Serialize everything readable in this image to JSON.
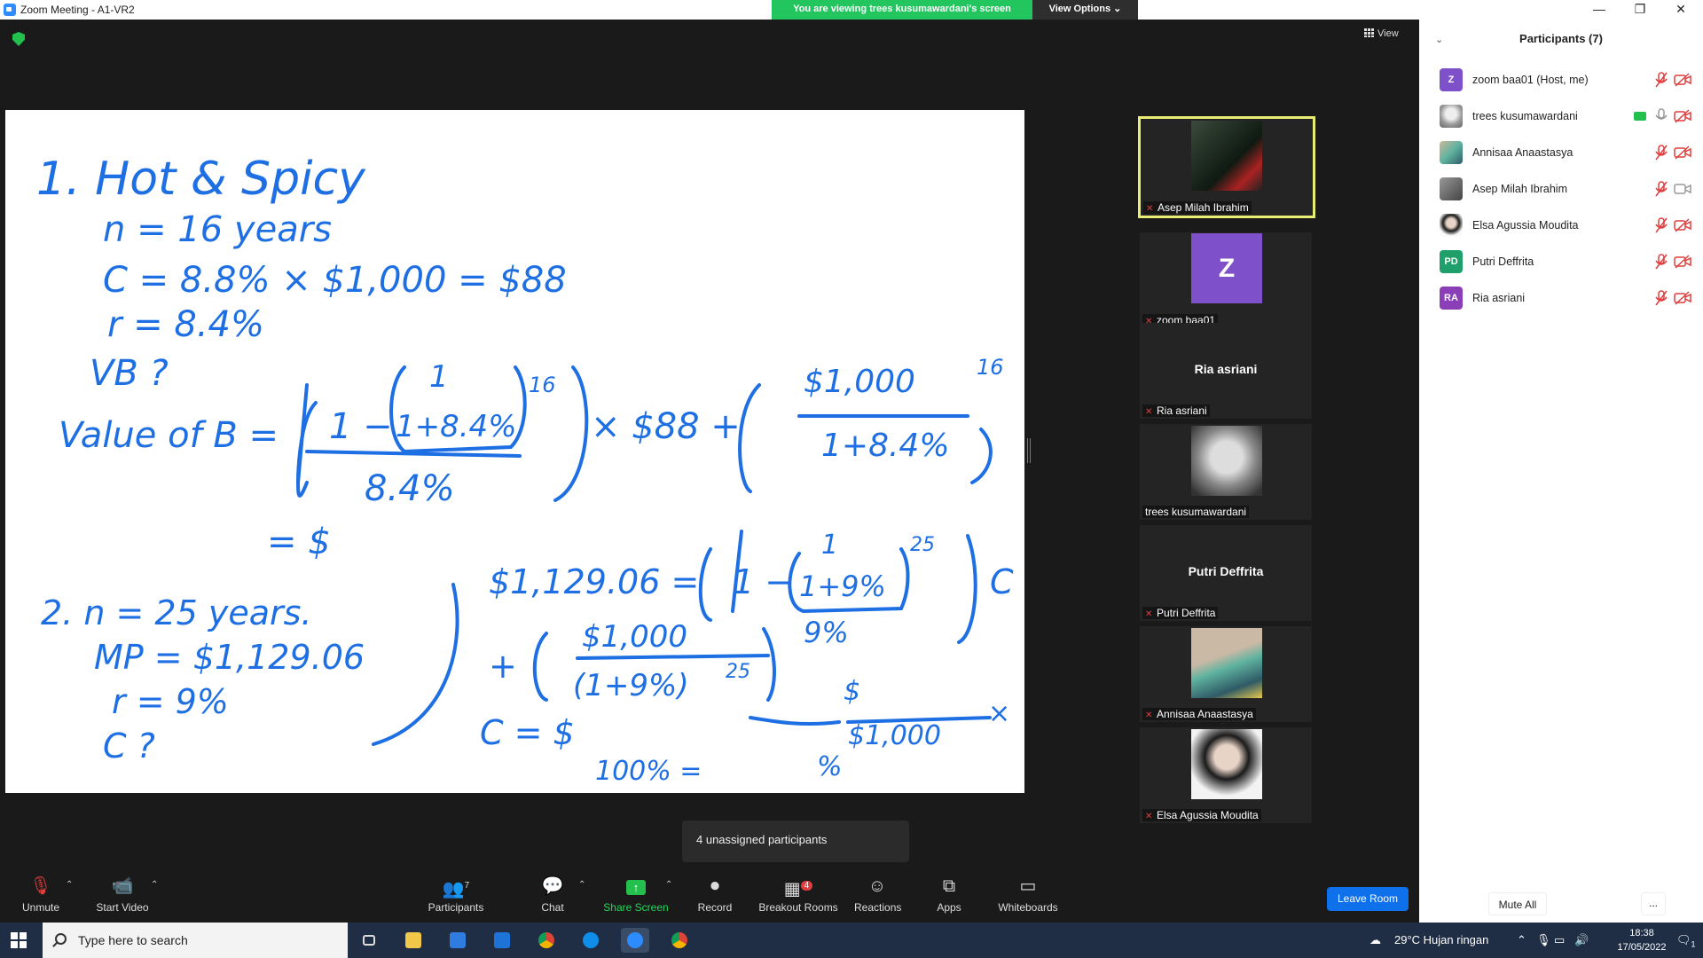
{
  "window": {
    "title": "Zoom Meeting - A1-VR2"
  },
  "banner": {
    "viewing_text": "You are viewing trees kusumawardani's screen",
    "view_options": "View Options"
  },
  "meeting": {
    "view_label": "View"
  },
  "whiteboard": {
    "line1": "1. Hot & Spicy",
    "line2": "n = 16 years",
    "line3": "C = 8.8% × $1,000 = $88",
    "line4": "r = 8.4%",
    "line5": "VB ?",
    "line6a": "Value of B =",
    "line6b": "1 −",
    "line6c": "1",
    "line6d": "1+8.4%",
    "line6e": "16",
    "line6f": "× $88 +",
    "line6g": "$1,000",
    "line6h": "1+8.4%",
    "line6i": "16",
    "line7": "8.4%",
    "line8": "= $",
    "q2_line1": "2. n = 25 years.",
    "q2_line2": "MP = $1,129.06",
    "q2_line3": "r = 9%",
    "q2_line4": "C ?",
    "q2_eq1": "$1,129.06 =",
    "q2_eq1b": "1 −",
    "q2_eq1c": "1",
    "q2_eq1d": "1+9%",
    "q2_eq1e": "25",
    "q2_eq1f": "C",
    "q2_eq2": "9%",
    "q2_plus": "+",
    "q2_frac_top": "$1,000",
    "q2_frac_bot": "(1+9%)",
    "q2_frac_exp": "25",
    "q2_c": "C = $",
    "q2_pct": "100% =",
    "q2_side_top": "$",
    "q2_side_mid": "$1,000",
    "q2_side_x": "×",
    "q2_side_bot": "%"
  },
  "tiles": [
    {
      "name": "Asep Milah Ibrahim"
    },
    {
      "name": "zoom baa01",
      "initial": "Z"
    },
    {
      "name": "Ria asriani",
      "big": "Ria asriani"
    },
    {
      "name": "trees kusumawardani"
    },
    {
      "name": "Putri Deffrita",
      "big": "Putri Deffrita"
    },
    {
      "name": "Annisaa Anaastasya"
    },
    {
      "name": "Elsa Agussia Moudita"
    }
  ],
  "popup": {
    "unassigned": "4 unassigned participants"
  },
  "toolbar": {
    "unmute": "Unmute",
    "start_video": "Start Video",
    "participants": "Participants",
    "participants_count": "7",
    "chat": "Chat",
    "share_screen": "Share Screen",
    "record": "Record",
    "breakout_rooms": "Breakout Rooms",
    "breakout_badge": "4",
    "reactions": "Reactions",
    "apps": "Apps",
    "whiteboards": "Whiteboards",
    "leave_room": "Leave Room"
  },
  "panel": {
    "title": "Participants (7)",
    "participants": [
      {
        "name": "zoom baa01 (Host, me)",
        "initials": "Z",
        "color": "#7e50c9"
      },
      {
        "name": "trees kusumawardani",
        "initials": "",
        "color": "#9a9a9a"
      },
      {
        "name": "Annisaa Anaastasya",
        "initials": "",
        "color": "#a7b59a"
      },
      {
        "name": "Asep Milah Ibrahim",
        "initials": "",
        "color": "#777777"
      },
      {
        "name": "Elsa Agussia Moudita",
        "initials": "",
        "color": "#d9c8bd"
      },
      {
        "name": "Putri Deffrita",
        "initials": "PD",
        "color": "#1fa06a"
      },
      {
        "name": "Ria asriani",
        "initials": "RA",
        "color": "#8a3fb8"
      }
    ],
    "mute_all": "Mute All",
    "more": "..."
  },
  "taskbar": {
    "search_placeholder": "Type here to search",
    "weather": "29°C  Hujan ringan",
    "time": "18:38",
    "date": "17/05/2022",
    "notif_count": "1"
  }
}
